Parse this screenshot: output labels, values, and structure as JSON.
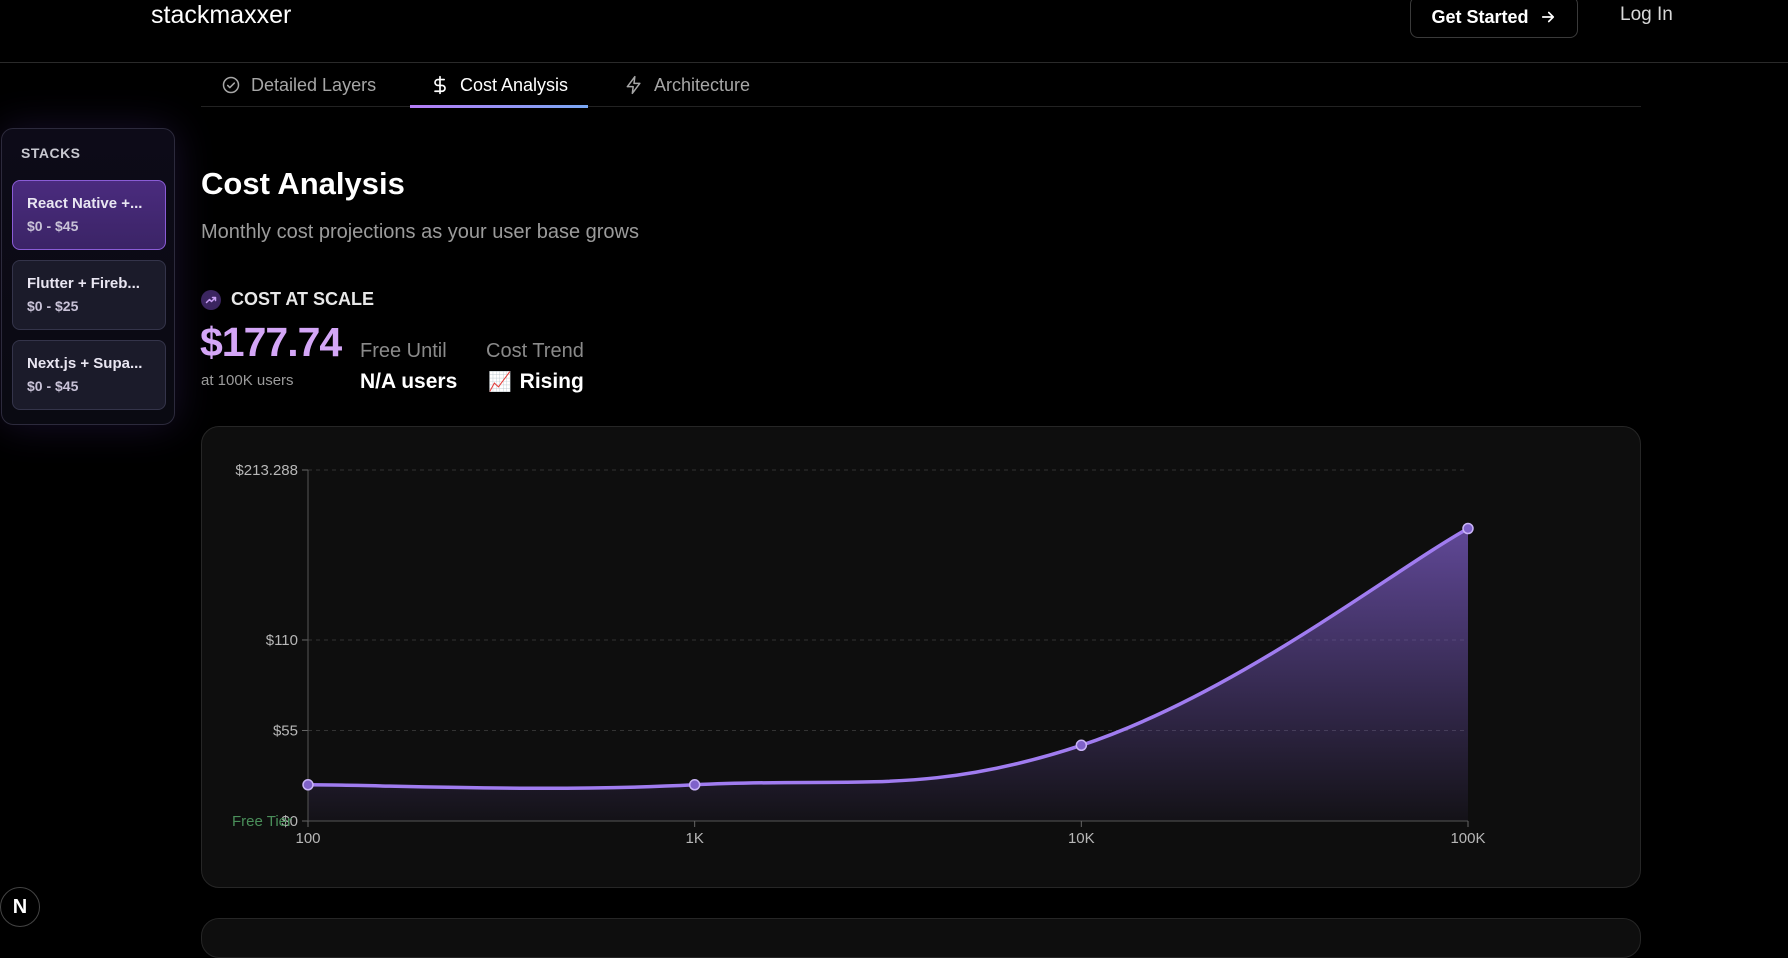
{
  "header": {
    "brand": "stackmaxxer",
    "get_started_label": "Get Started",
    "login_label": "Log In"
  },
  "tabs": [
    {
      "label": "Detailed Layers",
      "icon": "check-circle-icon",
      "active": false
    },
    {
      "label": "Cost Analysis",
      "icon": "dollar-icon",
      "active": true
    },
    {
      "label": "Architecture",
      "icon": "lightning-icon",
      "active": false
    }
  ],
  "sidebar": {
    "title": "STACKS",
    "items": [
      {
        "name": "React Native +...",
        "price": "$0 - $45",
        "active": true
      },
      {
        "name": "Flutter + Fireb...",
        "price": "$0 - $25",
        "active": false
      },
      {
        "name": "Next.js + Supa...",
        "price": "$0 - $45",
        "active": false
      }
    ]
  },
  "main": {
    "title": "Cost Analysis",
    "subtitle": "Monthly cost projections as your user base grows",
    "scale_heading": "COST AT SCALE",
    "big_cost": "$177.74",
    "at_users": "at 100K users",
    "free_until_label": "Free Until",
    "free_until_value": "N/A users",
    "cost_trend_label": "Cost Trend",
    "cost_trend_icon": "📈",
    "cost_trend_value": "Rising"
  },
  "colors": {
    "accent": "#a07cf0",
    "big_cost": "#d4a6f7",
    "free_tier": "#4a8f5a"
  },
  "chart_data": {
    "type": "area",
    "x": [
      "100",
      "1K",
      "10K",
      "100K"
    ],
    "values": [
      22,
      22,
      46,
      177.74
    ],
    "y_ticks": [
      {
        "value": 0,
        "label": "$0"
      },
      {
        "value": 55,
        "label": "$55"
      },
      {
        "value": 110,
        "label": "$110"
      },
      {
        "value": 213.288,
        "label": "$213.288"
      }
    ],
    "free_tier_label": "Free Tier",
    "ylim": [
      0,
      213.288
    ],
    "x_scale": "log",
    "grid": true
  },
  "badge": {
    "label": "N"
  }
}
